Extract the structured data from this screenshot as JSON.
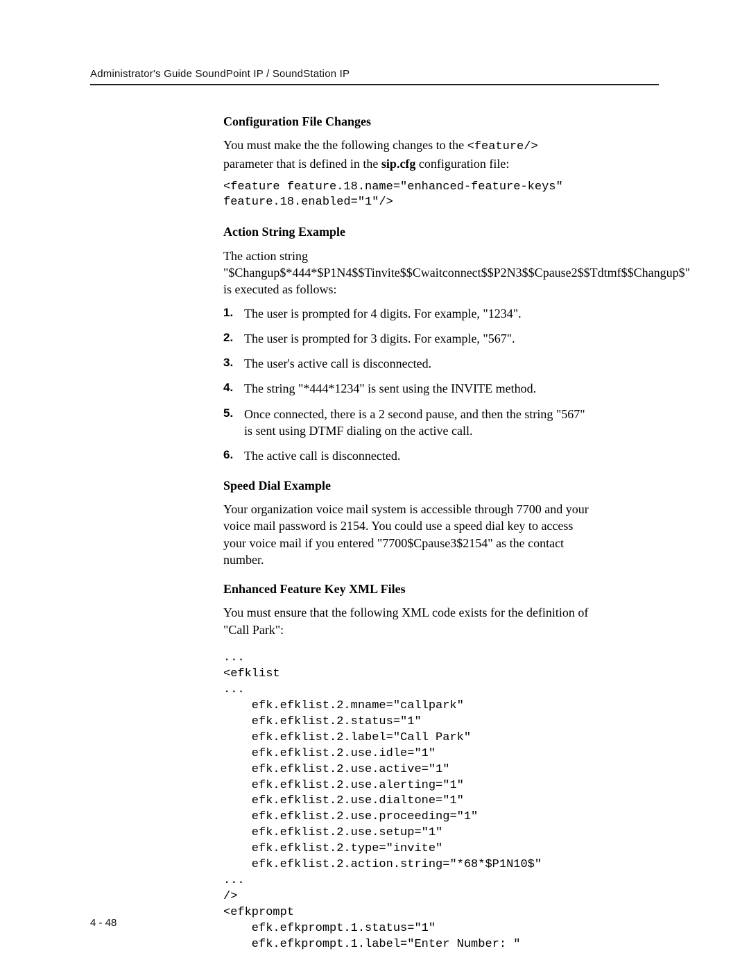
{
  "header": {
    "running_title": "Administrator's Guide SoundPoint IP / SoundStation IP"
  },
  "section_config_changes": {
    "heading": "Configuration File Changes",
    "para1_pre": "You must make the the following changes to the ",
    "para1_code": "<feature/>",
    "para1_mid": " parameter that is defined in the ",
    "para1_bold": "sip.cfg",
    "para1_post": " configuration file:",
    "code_block": "<feature feature.18.name=\"enhanced-feature-keys\"\nfeature.18.enabled=\"1\"/>"
  },
  "section_action_string": {
    "heading": "Action String Example",
    "intro_line1": "The action string",
    "intro_line2": "\"$Changup$*444*$P1N4$$Tinvite$$Cwaitconnect$$P2N3$$Cpause2$$Tdtmf$$Changup$\" is executed as follows:",
    "steps": [
      "The user is prompted for 4 digits. For example, \"1234\".",
      "The user is prompted for 3 digits. For example, \"567\".",
      "The user's active call is disconnected.",
      "The string \"*444*1234\" is sent using the INVITE method.",
      "Once connected, there is a 2 second pause, and then the string \"567\" is sent using DTMF dialing on the active call.",
      "The active call is disconnected."
    ]
  },
  "section_speed_dial": {
    "heading": "Speed Dial Example",
    "para": "Your organization voice mail system is accessible through 7700 and your voice mail password is 2154. You could use a speed dial key to access your voice mail if you entered \"7700$Cpause3$2154\" as the contact number."
  },
  "section_efk_xml": {
    "heading": "Enhanced Feature Key XML Files",
    "para": "You must ensure that the following XML code exists for the definition of \"Call Park\":",
    "code_block": "...\n<efklist\n...\n    efk.efklist.2.mname=\"callpark\"\n    efk.efklist.2.status=\"1\"\n    efk.efklist.2.label=\"Call Park\"\n    efk.efklist.2.use.idle=\"1\"\n    efk.efklist.2.use.active=\"1\"\n    efk.efklist.2.use.alerting=\"1\"\n    efk.efklist.2.use.dialtone=\"1\"\n    efk.efklist.2.use.proceeding=\"1\"\n    efk.efklist.2.use.setup=\"1\"\n    efk.efklist.2.type=\"invite\"\n    efk.efklist.2.action.string=\"*68*$P1N10$\"\n...\n/>\n<efkprompt\n    efk.efkprompt.1.status=\"1\"\n    efk.efkprompt.1.label=\"Enter Number: \""
  },
  "footer": {
    "page_number": "4 - 48"
  }
}
